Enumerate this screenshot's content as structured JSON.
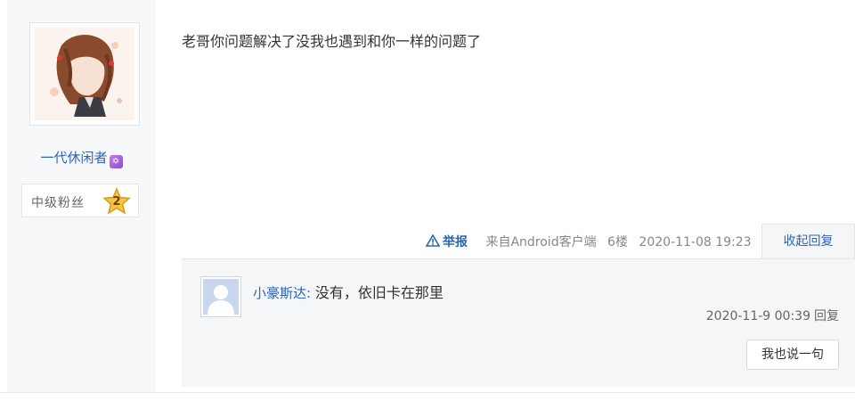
{
  "author": {
    "name": "一代休闲者",
    "level_label": "中级粉丝",
    "level_number": "2"
  },
  "post": {
    "text": "老哥你问题解决了没我也遇到和你一样的问题了",
    "report_label": "举报",
    "source": "来自Android客户端",
    "floor": "6楼",
    "time": "2020-11-08 19:23",
    "collapse_label": "收起回复"
  },
  "reply": {
    "user": "小豪斯达",
    "separator": ": ",
    "text": "没有，依旧卡在那里",
    "time": "2020-11-9 00:39",
    "reply_label": "回复",
    "say_button": "我也说一句"
  }
}
